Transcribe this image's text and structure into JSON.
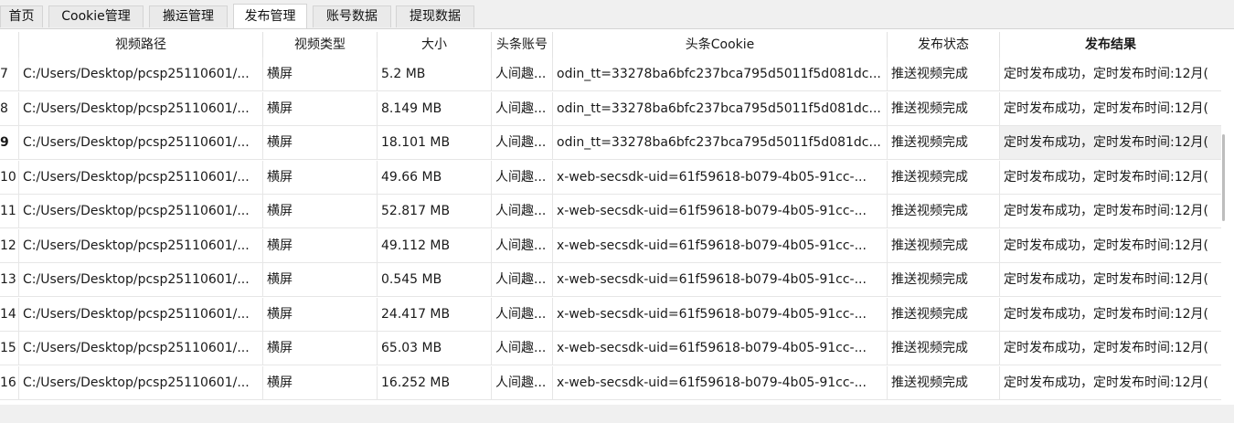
{
  "tabs": [
    {
      "label": "首页",
      "active": false
    },
    {
      "label": "Cookie管理",
      "active": false
    },
    {
      "label": "搬运管理",
      "active": false
    },
    {
      "label": "发布管理",
      "active": true
    },
    {
      "label": "账号数据",
      "active": false
    },
    {
      "label": "提现数据",
      "active": false
    }
  ],
  "table": {
    "columns": [
      "视频路径",
      "视频类型",
      "大小",
      "头条账号",
      "头条Cookie",
      "发布状态",
      "发布结果"
    ],
    "rows": [
      {
        "num": "7",
        "path": "C:/Users/Desktop/pcsp25110601/...",
        "type": "横屏",
        "size": "5.2 MB",
        "account": "人间趣...",
        "cookie": "odin_tt=33278ba6bfc237bca795d5011f5d081dc...",
        "status": "推送视频完成",
        "result": "定时发布成功，定时发布时间:12月("
      },
      {
        "num": "8",
        "path": "C:/Users/Desktop/pcsp25110601/...",
        "type": "横屏",
        "size": "8.149 MB",
        "account": "人间趣...",
        "cookie": "odin_tt=33278ba6bfc237bca795d5011f5d081dc...",
        "status": "推送视频完成",
        "result": "定时发布成功，定时发布时间:12月("
      },
      {
        "num": "9",
        "path": "C:/Users/Desktop/pcsp25110601/...",
        "type": "横屏",
        "size": "18.101 MB",
        "account": "人间趣...",
        "cookie": "odin_tt=33278ba6bfc237bca795d5011f5d081dc...",
        "status": "推送视频完成",
        "result": "定时发布成功，定时发布时间:12月("
      },
      {
        "num": "10",
        "path": "C:/Users/Desktop/pcsp25110601/...",
        "type": "横屏",
        "size": "49.66 MB",
        "account": "人间趣...",
        "cookie": "x-web-secsdk-uid=61f59618-b079-4b05-91cc-...",
        "status": "推送视频完成",
        "result": "定时发布成功，定时发布时间:12月("
      },
      {
        "num": "11",
        "path": "C:/Users/Desktop/pcsp25110601/...",
        "type": "横屏",
        "size": "52.817 MB",
        "account": "人间趣...",
        "cookie": "x-web-secsdk-uid=61f59618-b079-4b05-91cc-...",
        "status": "推送视频完成",
        "result": "定时发布成功，定时发布时间:12月("
      },
      {
        "num": "12",
        "path": "C:/Users/Desktop/pcsp25110601/...",
        "type": "横屏",
        "size": "49.112 MB",
        "account": "人间趣...",
        "cookie": "x-web-secsdk-uid=61f59618-b079-4b05-91cc-...",
        "status": "推送视频完成",
        "result": "定时发布成功，定时发布时间:12月("
      },
      {
        "num": "13",
        "path": "C:/Users/Desktop/pcsp25110601/...",
        "type": "横屏",
        "size": "0.545 MB",
        "account": "人间趣...",
        "cookie": "x-web-secsdk-uid=61f59618-b079-4b05-91cc-...",
        "status": "推送视频完成",
        "result": "定时发布成功，定时发布时间:12月("
      },
      {
        "num": "14",
        "path": "C:/Users/Desktop/pcsp25110601/...",
        "type": "横屏",
        "size": "24.417 MB",
        "account": "人间趣...",
        "cookie": "x-web-secsdk-uid=61f59618-b079-4b05-91cc-...",
        "status": "推送视频完成",
        "result": "定时发布成功，定时发布时间:12月("
      },
      {
        "num": "15",
        "path": "C:/Users/Desktop/pcsp25110601/...",
        "type": "横屏",
        "size": "65.03 MB",
        "account": "人间趣...",
        "cookie": "x-web-secsdk-uid=61f59618-b079-4b05-91cc-...",
        "status": "推送视频完成",
        "result": "定时发布成功，定时发布时间:12月("
      },
      {
        "num": "16",
        "path": "C:/Users/Desktop/pcsp25110601/...",
        "type": "横屏",
        "size": "16.252 MB",
        "account": "人间趣...",
        "cookie": "x-web-secsdk-uid=61f59618-b079-4b05-91cc-...",
        "status": "推送视频完成",
        "result": "定时发布成功，定时发布时间:12月("
      }
    ]
  }
}
